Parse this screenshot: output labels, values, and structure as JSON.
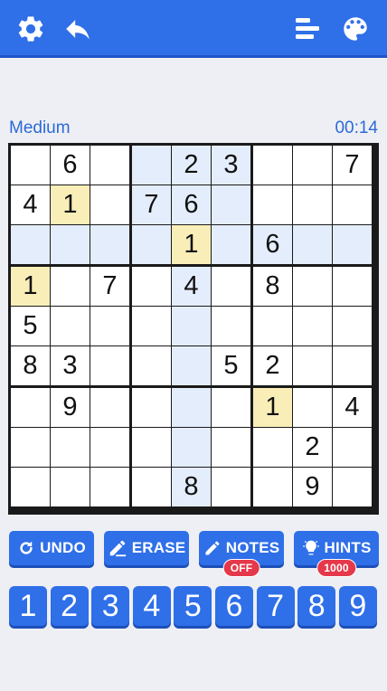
{
  "toolbar": {
    "settings_icon": "gear-icon",
    "back_icon": "reply-arrow-icon",
    "stats_icon": "bars-icon",
    "theme_icon": "palette-icon"
  },
  "game": {
    "difficulty": "Medium",
    "timer": "00:14"
  },
  "board": {
    "rows": [
      [
        "",
        "6",
        "",
        "",
        "2",
        "3",
        "",
        "",
        "7"
      ],
      [
        "4",
        "1",
        "",
        "7",
        "6",
        "",
        "",
        "",
        ""
      ],
      [
        "",
        "",
        "",
        "",
        "1",
        "",
        "6",
        "",
        ""
      ],
      [
        "1",
        "",
        "7",
        "",
        "4",
        "",
        "8",
        "",
        ""
      ],
      [
        "5",
        "",
        "",
        "",
        "",
        "",
        "",
        "",
        ""
      ],
      [
        "8",
        "3",
        "",
        "",
        "",
        "5",
        "2",
        "",
        ""
      ],
      [
        "",
        "9",
        "",
        "",
        "",
        "",
        "1",
        "",
        "4"
      ],
      [
        "",
        "",
        "",
        "",
        "",
        "",
        "",
        "2",
        ""
      ],
      [
        "",
        "",
        "",
        "",
        "8",
        "",
        "",
        "9",
        ""
      ]
    ],
    "selected": {
      "row": 2,
      "col": 4
    },
    "colors": {
      "highlight": "#e4edfb",
      "same_number": "#f9eeb8",
      "cell": "#ffffff",
      "grid": "#1a1a1a"
    }
  },
  "actions": {
    "undo_label": "UNDO",
    "erase_label": "ERASE",
    "notes_label": "NOTES",
    "notes_badge": "OFF",
    "hints_label": "HINTS",
    "hints_badge": "1000"
  },
  "numpad": [
    "1",
    "2",
    "3",
    "4",
    "5",
    "6",
    "7",
    "8",
    "9"
  ],
  "theme": {
    "accent": "#2f6fe8",
    "accent_dark": "#1d4fb8",
    "badge_red": "#e5384a",
    "text_blue": "#2a6ad8"
  }
}
